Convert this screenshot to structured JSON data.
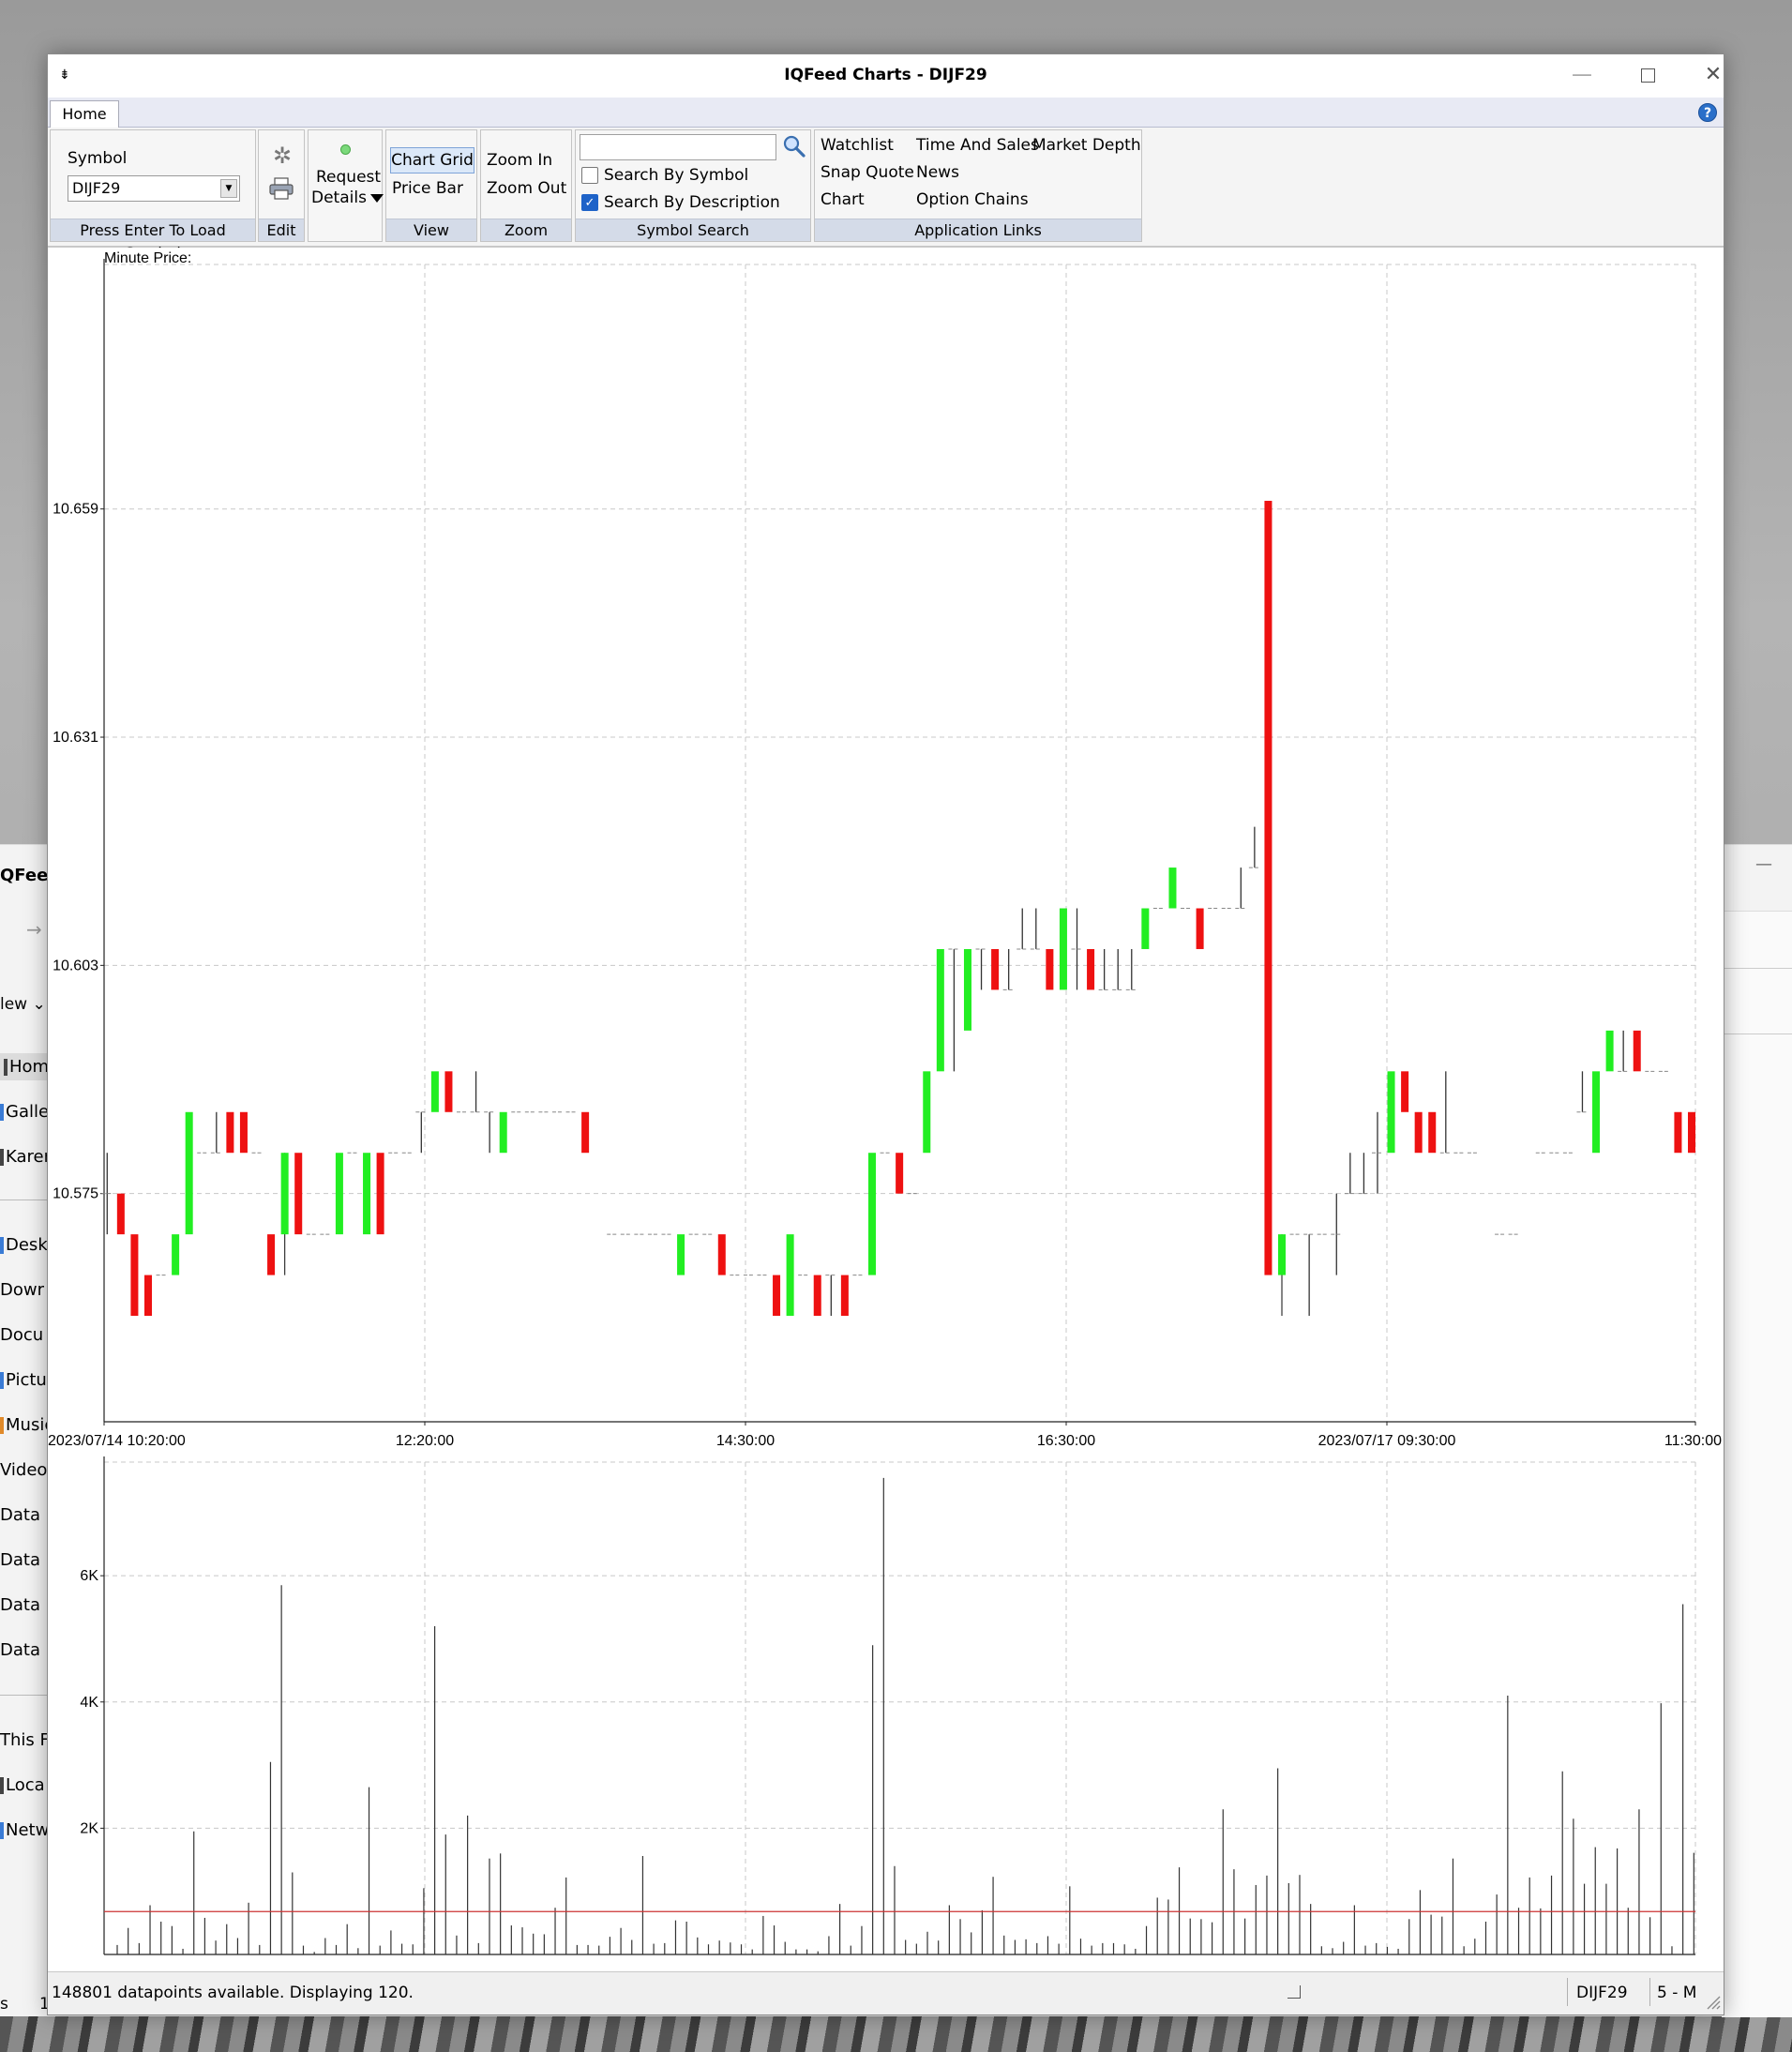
{
  "window": {
    "title": "IQFeed Charts - DIJF29",
    "menu_glyph": "⇟",
    "minimize_glyph": "—",
    "close_glyph": "✕"
  },
  "tabs": [
    {
      "label": "Home"
    }
  ],
  "help_glyph": "?",
  "ribbon": {
    "symbol_group": {
      "label": "Symbol",
      "value": "DIJF29",
      "caption": "Press Enter To Load Symbol"
    },
    "edit_group": {
      "caption": "Edit",
      "gear_glyph": "✲"
    },
    "request_group": {
      "label_line1": "Request",
      "label_line2": "Details"
    },
    "view_group": {
      "chart_grid": "Chart Grid",
      "price_bar": "Price Bar",
      "caption": "View"
    },
    "zoom_group": {
      "zoom_in": "Zoom In",
      "zoom_out": "Zoom Out",
      "caption": "Zoom"
    },
    "search_group": {
      "search_value": "",
      "by_symbol": {
        "label": "Search By Symbol",
        "checked": false
      },
      "by_description": {
        "label": "Search By Description",
        "checked": true
      },
      "check_glyph": "✓",
      "caption": "Symbol Search"
    },
    "links_group": {
      "watchlist": "Watchlist",
      "time_and_sales": "Time And Sales",
      "market_depth": "Market Depth",
      "snap_quote": "Snap Quote",
      "news": "News",
      "chart": "Chart",
      "option_chains": "Option Chains",
      "caption": "Application Links"
    }
  },
  "chart_data": [
    {
      "type": "candlestick",
      "title": "Minute Price:",
      "ylim": [
        10.547,
        10.689
      ],
      "y_ticks": [
        "10.575",
        "10.603",
        "10.631",
        "10.659"
      ],
      "x_ticks": [
        "2023/07/14 10:20:00",
        "12:20:00",
        "14:30:00",
        "16:30:00",
        "2023/07/17 09:30:00",
        "11:30:00"
      ],
      "grid": true,
      "colors": {
        "up": "#22ee22",
        "down": "#ee1111",
        "neutral": "#333333"
      },
      "bars": [
        [
          "n",
          10.575,
          10.58,
          10.57,
          10.58
        ],
        [
          "d",
          10.575,
          10.575,
          10.57,
          10.57
        ],
        [
          "d",
          10.57,
          10.57,
          10.56,
          10.56
        ],
        [
          "d",
          10.565,
          10.565,
          10.56,
          10.56
        ],
        [
          "n",
          10.565,
          10.565,
          10.565,
          10.565
        ],
        [
          "u",
          10.565,
          10.57,
          10.565,
          10.57
        ],
        [
          "u",
          10.57,
          10.585,
          10.57,
          10.585
        ],
        [
          "n",
          10.58,
          10.58,
          10.58,
          10.58
        ],
        [
          "n",
          10.58,
          10.585,
          10.58,
          10.58
        ],
        [
          "d",
          10.585,
          10.585,
          10.58,
          10.58
        ],
        [
          "d",
          10.585,
          10.585,
          10.58,
          10.58
        ],
        [
          "n",
          10.58,
          10.58,
          10.58,
          10.58
        ],
        [
          "d",
          10.57,
          10.57,
          10.565,
          10.565
        ],
        [
          "u",
          10.57,
          10.58,
          10.565,
          10.58
        ],
        [
          "d",
          10.58,
          10.58,
          10.57,
          10.57
        ],
        [
          "n",
          10.57,
          10.57,
          10.57,
          10.57
        ],
        [
          "n",
          10.57,
          10.57,
          10.57,
          10.57
        ],
        [
          "u",
          10.57,
          10.58,
          10.57,
          10.58
        ],
        [
          "n",
          10.58,
          10.58,
          10.58,
          10.58
        ],
        [
          "u",
          10.57,
          10.58,
          10.57,
          10.58
        ],
        [
          "d",
          10.58,
          10.58,
          10.57,
          10.57
        ],
        [
          "n",
          10.58,
          10.58,
          10.58,
          10.58
        ],
        [
          "n",
          10.58,
          10.58,
          10.58,
          10.58
        ],
        [
          "n",
          10.585,
          10.585,
          10.58,
          10.585
        ],
        [
          "u",
          10.585,
          10.59,
          10.585,
          10.59
        ],
        [
          "d",
          10.59,
          10.59,
          10.585,
          10.585
        ],
        [
          "n",
          10.585,
          10.585,
          10.585,
          10.585
        ],
        [
          "n",
          10.585,
          10.59,
          10.585,
          10.585
        ],
        [
          "n",
          10.585,
          10.585,
          10.58,
          10.585
        ],
        [
          "u",
          10.58,
          10.585,
          10.58,
          10.585
        ],
        [
          "n",
          10.585,
          10.585,
          10.585,
          10.585
        ],
        [
          "n",
          10.585,
          10.585,
          10.585,
          10.585
        ],
        [
          "n",
          10.585,
          10.585,
          10.585,
          10.585
        ],
        [
          "n",
          10.585,
          10.585,
          10.585,
          10.585
        ],
        [
          "n",
          10.585,
          10.585,
          10.585,
          10.585
        ],
        [
          "d",
          10.585,
          10.585,
          10.58,
          10.58
        ],
        [
          "g"
        ],
        [
          "n",
          10.57,
          10.57,
          10.57,
          10.57
        ],
        [
          "n",
          10.57,
          10.57,
          10.57,
          10.57
        ],
        [
          "n",
          10.57,
          10.57,
          10.57,
          10.57
        ],
        [
          "n",
          10.57,
          10.57,
          10.57,
          10.57
        ],
        [
          "n",
          10.57,
          10.57,
          10.57,
          10.57
        ],
        [
          "u",
          10.565,
          10.57,
          10.565,
          10.57
        ],
        [
          "n",
          10.57,
          10.57,
          10.57,
          10.57
        ],
        [
          "n",
          10.57,
          10.57,
          10.57,
          10.57
        ],
        [
          "d",
          10.57,
          10.57,
          10.565,
          10.565
        ],
        [
          "n",
          10.565,
          10.565,
          10.565,
          10.565
        ],
        [
          "n",
          10.565,
          10.565,
          10.565,
          10.565
        ],
        [
          "n",
          10.565,
          10.565,
          10.565,
          10.565
        ],
        [
          "d",
          10.565,
          10.565,
          10.56,
          10.56
        ],
        [
          "u",
          10.56,
          10.57,
          10.56,
          10.57
        ],
        [
          "n",
          10.565,
          10.565,
          10.565,
          10.565
        ],
        [
          "d",
          10.565,
          10.565,
          10.56,
          10.56
        ],
        [
          "n",
          10.565,
          10.565,
          10.56,
          10.56
        ],
        [
          "d",
          10.565,
          10.565,
          10.56,
          10.56
        ],
        [
          "n",
          10.565,
          10.565,
          10.565,
          10.565
        ],
        [
          "u",
          10.565,
          10.58,
          10.565,
          10.58
        ],
        [
          "n",
          10.58,
          10.58,
          10.58,
          10.58
        ],
        [
          "d",
          10.58,
          10.58,
          10.575,
          10.575
        ],
        [
          "n",
          10.575,
          10.575,
          10.575,
          10.575
        ],
        [
          "u",
          10.58,
          10.59,
          10.58,
          10.59
        ],
        [
          "u",
          10.59,
          10.605,
          10.59,
          10.605
        ],
        [
          "n",
          10.605,
          10.605,
          10.59,
          10.595
        ],
        [
          "u",
          10.595,
          10.605,
          10.595,
          10.605
        ],
        [
          "n",
          10.605,
          10.605,
          10.6,
          10.605
        ],
        [
          "d",
          10.605,
          10.605,
          10.6,
          10.6
        ],
        [
          "n",
          10.6,
          10.605,
          10.6,
          10.605
        ],
        [
          "n",
          10.605,
          10.61,
          10.605,
          10.605
        ],
        [
          "n",
          10.605,
          10.61,
          10.605,
          10.605
        ],
        [
          "d",
          10.605,
          10.605,
          10.6,
          10.6
        ],
        [
          "u",
          10.6,
          10.61,
          10.6,
          10.61
        ],
        [
          "n",
          10.605,
          10.61,
          10.6,
          10.605
        ],
        [
          "d",
          10.605,
          10.605,
          10.6,
          10.6
        ],
        [
          "n",
          10.6,
          10.605,
          10.6,
          10.6
        ],
        [
          "n",
          10.6,
          10.605,
          10.6,
          10.6
        ],
        [
          "n",
          10.6,
          10.605,
          10.6,
          10.6
        ],
        [
          "u",
          10.605,
          10.61,
          10.605,
          10.61
        ],
        [
          "n",
          10.61,
          10.61,
          10.61,
          10.61
        ],
        [
          "u",
          10.61,
          10.615,
          10.61,
          10.615
        ],
        [
          "n",
          10.61,
          10.61,
          10.61,
          10.61
        ],
        [
          "d",
          10.61,
          10.61,
          10.605,
          10.605
        ],
        [
          "n",
          10.61,
          10.61,
          10.61,
          10.61
        ],
        [
          "n",
          10.61,
          10.61,
          10.61,
          10.61
        ],
        [
          "n",
          10.61,
          10.615,
          10.61,
          10.61
        ],
        [
          "n",
          10.615,
          10.62,
          10.615,
          10.62
        ],
        [
          "d",
          10.66,
          10.66,
          10.565,
          10.565
        ],
        [
          "u",
          10.565,
          10.57,
          10.56,
          10.57
        ],
        [
          "n",
          10.57,
          10.57,
          10.57,
          10.57
        ],
        [
          "n",
          10.57,
          10.57,
          10.56,
          10.57
        ],
        [
          "n",
          10.57,
          10.57,
          10.57,
          10.57
        ],
        [
          "n",
          10.57,
          10.575,
          10.565,
          10.57
        ],
        [
          "n",
          10.575,
          10.58,
          10.575,
          10.575
        ],
        [
          "n",
          10.575,
          10.58,
          10.575,
          10.575
        ],
        [
          "n",
          10.58,
          10.585,
          10.575,
          10.58
        ],
        [
          "u",
          10.58,
          10.59,
          10.58,
          10.59
        ],
        [
          "d",
          10.59,
          10.59,
          10.585,
          10.585
        ],
        [
          "d",
          10.585,
          10.585,
          10.58,
          10.58
        ],
        [
          "d",
          10.585,
          10.585,
          10.58,
          10.58
        ],
        [
          "n",
          10.58,
          10.59,
          10.58,
          10.58
        ],
        [
          "n",
          10.58,
          10.58,
          10.58,
          10.58
        ],
        [
          "n",
          10.58,
          10.58,
          10.58,
          10.58
        ],
        [
          "g"
        ],
        [
          "n",
          10.57,
          10.57,
          10.57,
          10.57
        ],
        [
          "n",
          10.57,
          10.57,
          10.57,
          10.57
        ],
        [
          "g"
        ],
        [
          "n",
          10.58,
          10.58,
          10.58,
          10.58
        ],
        [
          "n",
          10.58,
          10.58,
          10.58,
          10.58
        ],
        [
          "n",
          10.58,
          10.58,
          10.58,
          10.58
        ],
        [
          "n",
          10.585,
          10.59,
          10.585,
          10.585
        ],
        [
          "u",
          10.58,
          10.59,
          10.58,
          10.59
        ],
        [
          "u",
          10.59,
          10.595,
          10.59,
          10.595
        ],
        [
          "n",
          10.59,
          10.595,
          10.59,
          10.59
        ],
        [
          "d",
          10.595,
          10.595,
          10.59,
          10.59
        ],
        [
          "n",
          10.59,
          10.59,
          10.59,
          10.59
        ],
        [
          "n",
          10.59,
          10.59,
          10.59,
          10.59
        ],
        [
          "d",
          10.585,
          10.585,
          10.58,
          10.58
        ],
        [
          "d",
          10.585,
          10.585,
          10.58,
          10.58
        ]
      ]
    },
    {
      "type": "bar",
      "title": "",
      "ylim": [
        0,
        7800
      ],
      "y_ticks": [
        "2K",
        "4K",
        "6K"
      ],
      "average": 680,
      "colors": {
        "bar": "#333333",
        "average": "#cc3333"
      },
      "values": [
        150,
        420,
        180,
        780,
        520,
        450,
        90,
        1950,
        580,
        220,
        480,
        260,
        820,
        150,
        3050,
        5850,
        1300,
        140,
        40,
        260,
        150,
        480,
        100,
        2650,
        140,
        380,
        170,
        160,
        1050,
        5200,
        1900,
        300,
        2200,
        180,
        1520,
        1600,
        460,
        430,
        330,
        320,
        740,
        1220,
        150,
        150,
        140,
        280,
        420,
        230,
        1560,
        170,
        180,
        540,
        520,
        270,
        160,
        220,
        190,
        160,
        80,
        610,
        460,
        200,
        80,
        80,
        50,
        290,
        800,
        140,
        450,
        4900,
        7550,
        1400,
        230,
        170,
        360,
        220,
        780,
        560,
        350,
        700,
        1230,
        300,
        230,
        240,
        180,
        290,
        170,
        1080,
        250,
        140,
        180,
        180,
        160,
        90,
        450,
        900,
        870,
        1380,
        570,
        560,
        510,
        2300,
        1350,
        570,
        1100,
        1250,
        2950,
        1130,
        1260,
        800,
        130,
        100,
        200,
        780,
        140,
        180,
        120,
        90,
        560,
        1020,
        630,
        600,
        1520,
        130,
        250,
        520,
        950,
        4100,
        740,
        1220,
        730,
        1250,
        2900,
        2150,
        1120,
        1700,
        1120,
        1680,
        740,
        2300,
        590,
        3980,
        130,
        5550,
        1610
      ]
    }
  ],
  "status": {
    "text": "148801 datapoints available.  Displaying 120.",
    "symbol": "DIJF29",
    "interval": "5 - M"
  },
  "background_explorer": {
    "title": "QFeed",
    "arrow_glyph": "→",
    "view_label": "lew ⌄",
    "minimize_glyph": "—",
    "items": [
      "Home",
      "Galler",
      "Karen",
      "Deskt",
      "Dowr",
      "Docu",
      "Pictur",
      "Music",
      "Video",
      "Data",
      "Data",
      "Data",
      "Data",
      "This F",
      "Loca",
      "Netw"
    ],
    "footer_left": "s",
    "footer_right": "1"
  }
}
